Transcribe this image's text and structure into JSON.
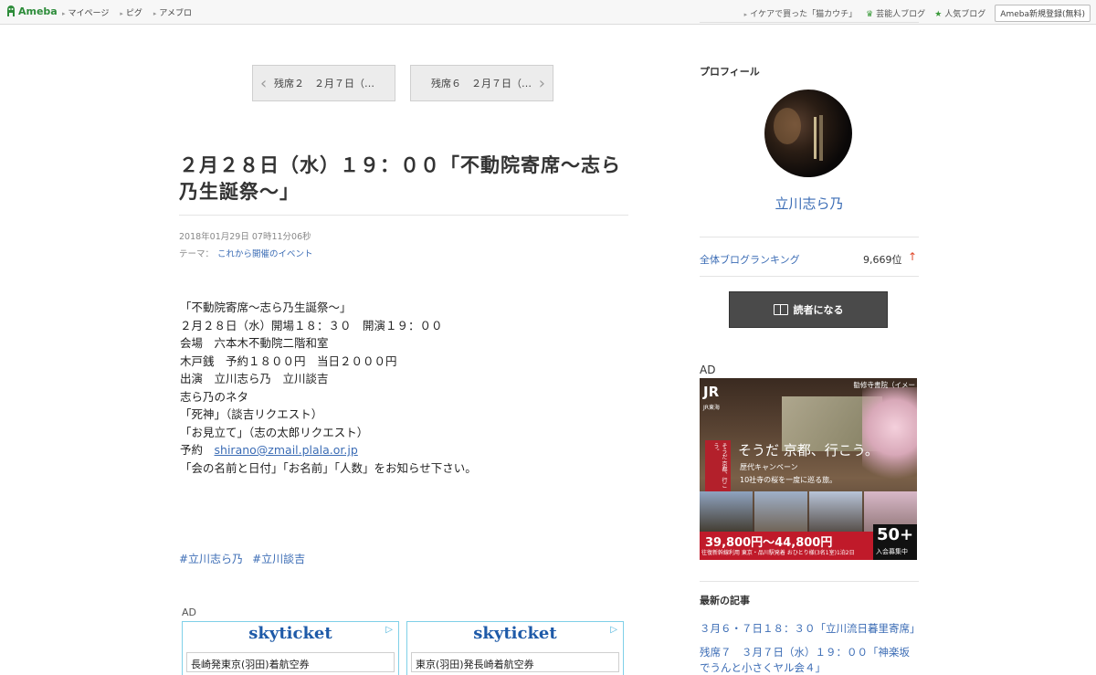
{
  "topbar": {
    "logo_text": "Ameba",
    "nav": [
      "マイページ",
      "ピグ",
      "アメブロ"
    ],
    "right_links": [
      "イケアで買った「猫カウチ」",
      "芸能人ブログ",
      "人気ブログ"
    ],
    "register_label": "Ameba新規登録(無料)"
  },
  "pager": {
    "prev_label": "残席２　２月７日（…",
    "next_label": "残席６　２月７日（…"
  },
  "article": {
    "title": "２月２８日（水）１９：００「不動院寄席〜志ら乃生誕祭〜」",
    "date": "2018年01月29日 07時11分06秒",
    "theme_label": "テーマ：",
    "theme_value": "これから開催のイベント",
    "lines": [
      "「不動院寄席〜志ら乃生誕祭〜」",
      "２月２８日（水）開場１８：３０　開演１９：００",
      "会場　六本木不動院二階和室",
      "木戸銭　予約１８００円　当日２０００円",
      "出演　立川志ら乃　立川談吉",
      "志ら乃のネタ",
      "「死神」（談吉リクエスト）",
      "「お見立て」（志の太郎リクエスト）"
    ],
    "reserve_label": "予約　",
    "reserve_email": "shirano@zmail.plala.or.jp",
    "notice": "「会の名前と日付」「お名前」「人数」をお知らせ下さい。",
    "hashtags": [
      "#立川志ら乃",
      "#立川談吉"
    ]
  },
  "ads_bottom": {
    "label": "AD",
    "items": [
      {
        "brand": "skyticket",
        "route": "長崎発東京(羽田)着航空券"
      },
      {
        "brand": "skyticket",
        "route": "東京(羽田)発長崎着航空券"
      }
    ]
  },
  "sidebar": {
    "profile_heading": "プロフィール",
    "profile_name": "立川志ら乃",
    "ranking_label": "全体ブログランキング",
    "ranking_value": "9,669位",
    "reader_button": "読者になる",
    "ad_label": "AD",
    "jr_ad": {
      "logo": "JR",
      "logo_sub": "JR東海",
      "tag": "勧修寺書院（イメー",
      "red_box": "そうだ 京都、行こう。",
      "catch": "そうだ 京都、行こう。",
      "campaign": "歴代キャンペーン",
      "sub": "10社寺の桜を一度に巡る旅。",
      "price": "39,800円〜44,800円",
      "price_sub": "往復新幹線利用 東京・品川駅発着 おひとり様(3名1室)1泊2日",
      "badge_num": "50+",
      "badge_text": "入会募集中"
    },
    "latest_heading": "最新の記事",
    "latest_items": [
      "３月６・７日１８：３０「立川流日暮里寄席」",
      "残席７　３月７日（水）１９：００「神楽坂でうんと小さくヤル会４」"
    ]
  },
  "colors": {
    "link": "#3b6cb5",
    "ameba_green": "#2d8c3a",
    "button_dark": "#4a4a4a",
    "rank_up": "#e04a2c"
  }
}
